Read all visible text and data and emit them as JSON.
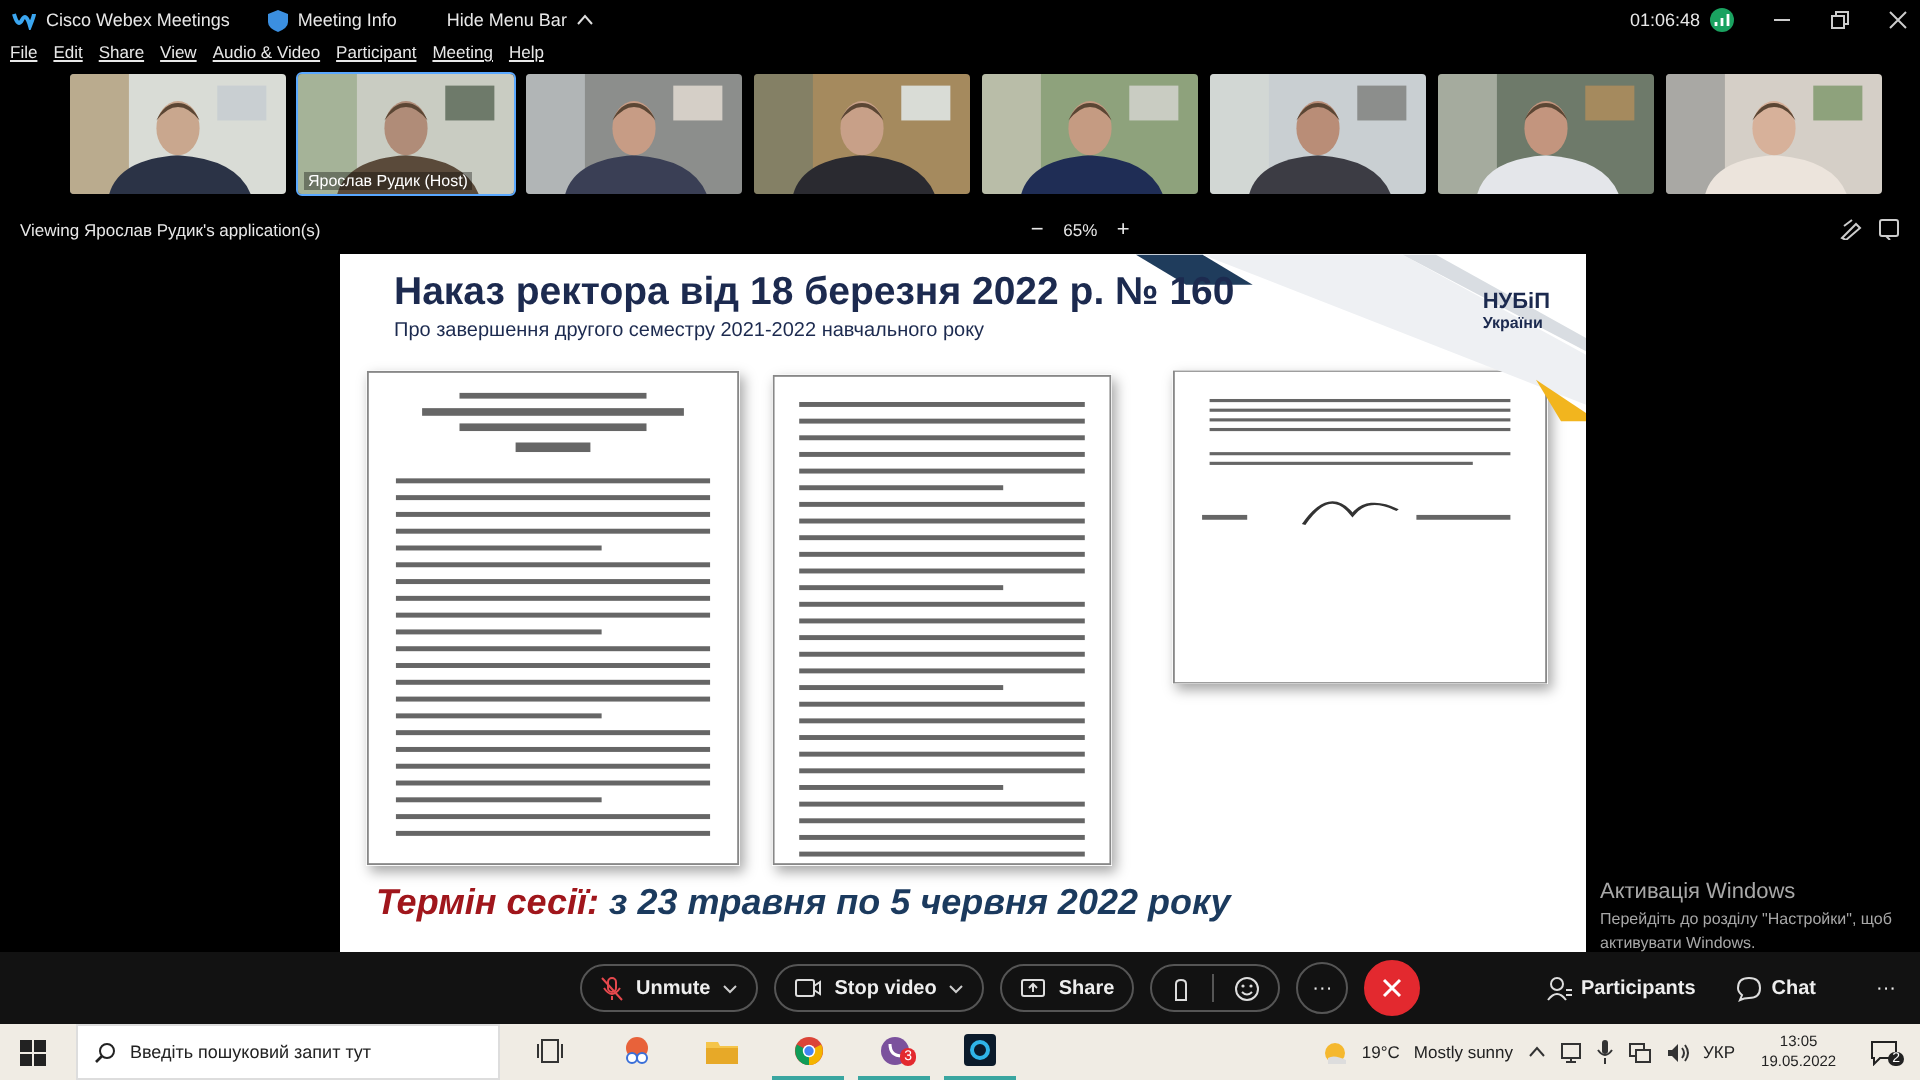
{
  "app": {
    "title": "Cisco Webex Meetings",
    "meeting_info": "Meeting Info",
    "hide_menu": "Hide Menu Bar",
    "clock": "01:06:48"
  },
  "menu": [
    "File",
    "Edit",
    "Share",
    "View",
    "Audio & Video",
    "Participant",
    "Meeting",
    "Help"
  ],
  "videos": [
    {
      "kind": "picture",
      "selected": false
    },
    {
      "kind": "picture",
      "selected": true,
      "label": "Ярослав Рудик (Host)"
    },
    {
      "kind": "picture",
      "selected": false
    },
    {
      "kind": "picture",
      "selected": false
    },
    {
      "kind": "picture",
      "selected": false
    },
    {
      "kind": "picture",
      "selected": false
    },
    {
      "kind": "picture",
      "selected": false
    },
    {
      "kind": "picture",
      "selected": false
    }
  ],
  "share_bar": {
    "viewing": "Viewing Ярослав Рудик's application(s)",
    "zoom_out": "−",
    "zoom": "65%",
    "zoom_in": "+"
  },
  "slide": {
    "title": "Наказ ректора від 18 березня 2022 р. № 160",
    "subtitle": "Про завершення другого семестру 2021-2022 навчального року",
    "logo": [
      "НУБіП",
      "України"
    ],
    "session_label": "Термін сесії:",
    "session_dates": "з 23 травня по 5 червня 2022 року"
  },
  "activation": {
    "title": "Активація Windows",
    "text": "Перейдіть до розділу \"Настройки\", щоб активувати Windows."
  },
  "controls": {
    "unmute": "Unmute",
    "stop_video": "Stop video",
    "share": "Share",
    "more": "···",
    "participants": "Participants",
    "chat": "Chat",
    "overflow": "···"
  },
  "taskbar": {
    "search_placeholder": "Введіть пошуковий запит тут",
    "apps": [
      {
        "kind": "taskview",
        "active": false
      },
      {
        "kind": "snip",
        "active": false
      },
      {
        "kind": "folder",
        "active": false
      },
      {
        "kind": "chrome",
        "active": true
      },
      {
        "kind": "viber",
        "active": true,
        "badge": "3"
      },
      {
        "kind": "webex",
        "active": true
      }
    ],
    "temperature": "19°C",
    "weather": "Mostly sunny",
    "language": "УКР",
    "time": "13:05",
    "date": "19.05.2022",
    "notifications": "2"
  }
}
